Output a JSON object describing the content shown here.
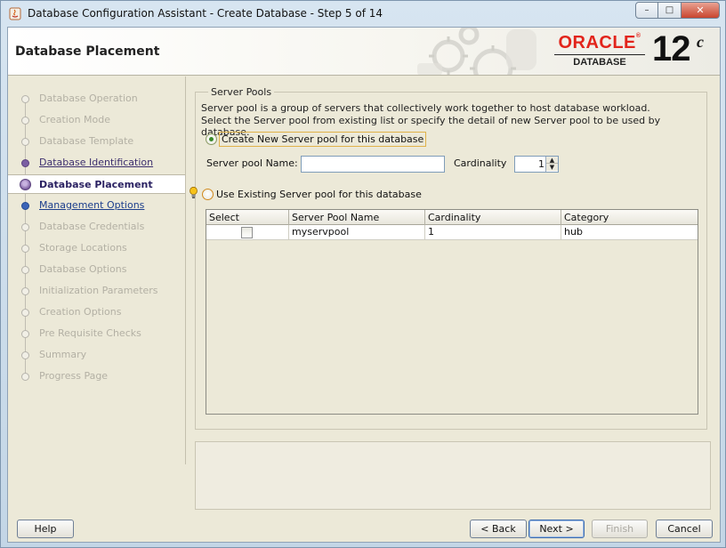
{
  "window": {
    "title": "Database Configuration Assistant - Create Database - Step 5 of 14",
    "controls": {
      "minimize": "–",
      "maximize": "□",
      "close": "✕"
    }
  },
  "banner": {
    "title": "Database Placement",
    "logo_word": "ORACLE",
    "logo_registered": "®",
    "logo_sub": "DATABASE",
    "version_number": "12",
    "version_suffix": "c"
  },
  "nav": {
    "items": [
      {
        "label": "Database Operation",
        "state": "inactive"
      },
      {
        "label": "Creation Mode",
        "state": "inactive"
      },
      {
        "label": "Database Template",
        "state": "inactive"
      },
      {
        "label": "Database Identification",
        "state": "done"
      },
      {
        "label": "Database Placement",
        "state": "current"
      },
      {
        "label": "Management Options",
        "state": "next"
      },
      {
        "label": "Database Credentials",
        "state": "inactive"
      },
      {
        "label": "Storage Locations",
        "state": "inactive"
      },
      {
        "label": "Database Options",
        "state": "inactive"
      },
      {
        "label": "Initialization Parameters",
        "state": "inactive"
      },
      {
        "label": "Creation Options",
        "state": "inactive"
      },
      {
        "label": "Pre Requisite Checks",
        "state": "inactive"
      },
      {
        "label": "Summary",
        "state": "inactive"
      },
      {
        "label": "Progress Page",
        "state": "inactive"
      }
    ]
  },
  "server_pools": {
    "group_title": "Server Pools",
    "desc_line1": "Server pool is a group of servers that collectively work together to host database workload.",
    "desc_line2": "Select the Server pool from existing list or specify the detail of new Server pool to be used by database.",
    "create_new_label": "Create New Server pool for this database",
    "create_new_selected": true,
    "pool_name_label": "Server pool Name:",
    "pool_name_value": "",
    "cardinality_label": "Cardinality",
    "cardinality_value": "1",
    "use_existing_label": "Use Existing Server pool for this database",
    "table": {
      "columns": [
        "Select",
        "Server Pool Name",
        "Cardinality",
        "Category"
      ],
      "rows": [
        {
          "selected": false,
          "name": "myservpool",
          "cardinality": "1",
          "category": "hub"
        }
      ]
    }
  },
  "footer": {
    "help": "Help",
    "back": "< Back",
    "next": "Next >",
    "finish": "Finish",
    "cancel": "Cancel"
  },
  "colors": {
    "oracle_red": "#e2241b",
    "nav_current": "#2a2162",
    "nav_next": "#1c3e8c",
    "panel_bg": "#ece9d8"
  }
}
